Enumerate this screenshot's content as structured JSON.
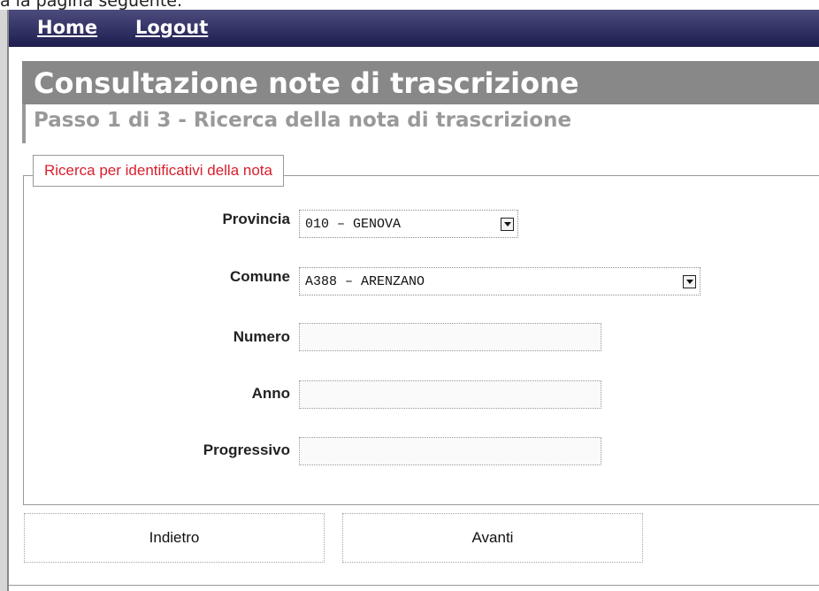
{
  "top_fragment": "a la pagina seguente.",
  "nav": {
    "home_label": "Home",
    "logout_label": "Logout"
  },
  "header": {
    "title": "Consultazione note di trascrizione",
    "subtitle": "Passo 1 di 3 - Ricerca della nota di trascrizione"
  },
  "search_section": {
    "legend": "Ricerca per identificativi della nota",
    "fields": {
      "provincia": {
        "label": "Provincia",
        "value": "010 – GENOVA"
      },
      "comune": {
        "label": "Comune",
        "value": "A388 – ARENZANO"
      },
      "numero": {
        "label": "Numero",
        "value": ""
      },
      "anno": {
        "label": "Anno",
        "value": ""
      },
      "progressivo": {
        "label": "Progressivo",
        "value": ""
      }
    }
  },
  "actions": {
    "back_label": "Indietro",
    "next_label": "Avanti"
  },
  "colors": {
    "nav_background": "#2a2a5c",
    "title_background": "#888888",
    "legend_text": "#d71f2c",
    "subtitle_text": "#999999"
  },
  "icons": {
    "dropdown": "chevron-down-icon"
  }
}
